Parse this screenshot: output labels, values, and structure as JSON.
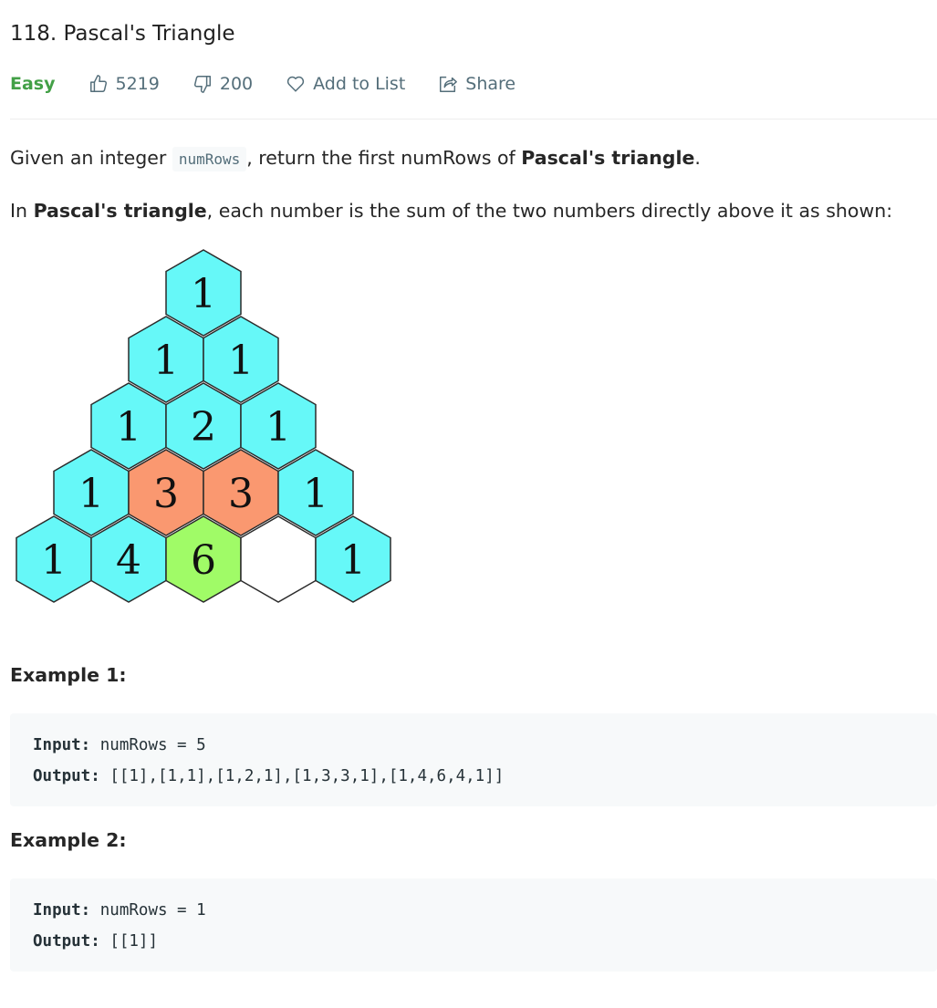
{
  "problem": {
    "title": "118. Pascal's Triangle",
    "difficulty": "Easy",
    "likes": "5219",
    "dislikes": "200",
    "add_to_list": "Add to List",
    "share": "Share"
  },
  "description": {
    "p1_a": "Given an integer ",
    "p1_code": "numRows",
    "p1_b": ", return the first numRows of ",
    "p1_bold": "Pascal's triangle",
    "p1_c": ".",
    "p2_a": "In ",
    "p2_bold": "Pascal's triangle",
    "p2_b": ", each number is the sum of the two numbers directly above it as shown:"
  },
  "figure": {
    "rows": [
      [
        "1"
      ],
      [
        "1",
        "1"
      ],
      [
        "1",
        "2",
        "1"
      ],
      [
        "1",
        "3",
        "3",
        "1"
      ],
      [
        "1",
        "4",
        "6",
        "",
        "1"
      ]
    ],
    "colors": {
      "cyan": "#66f8f8",
      "orange": "#fa9870",
      "green": "#a0fb67",
      "white": "#ffffff"
    }
  },
  "examples": [
    {
      "title": "Example 1:",
      "input_label": "Input:",
      "input": "numRows = 5",
      "output_label": "Output:",
      "output": "[[1],[1,1],[1,2,1],[1,3,3,1],[1,4,6,4,1]]"
    },
    {
      "title": "Example 2:",
      "input_label": "Input:",
      "input": "numRows = 1",
      "output_label": "Output:",
      "output": "[[1]]"
    }
  ]
}
